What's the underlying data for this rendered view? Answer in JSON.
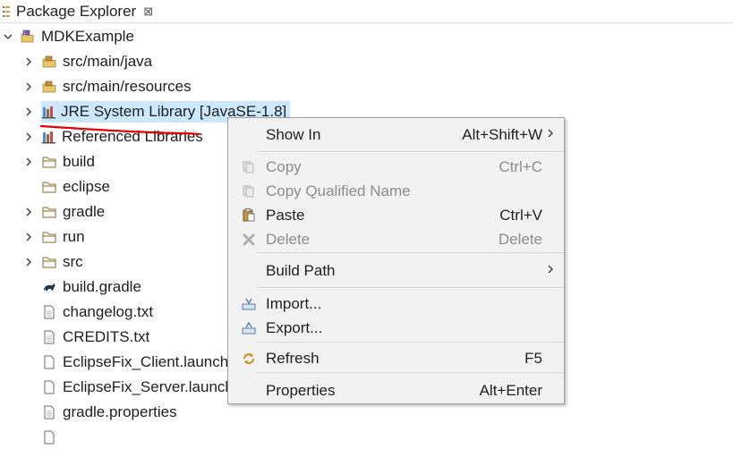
{
  "view": {
    "title": "Package Explorer",
    "close_glyph": "⊠"
  },
  "tree": {
    "project": "MDKExample",
    "items": [
      {
        "label": "src/main/java",
        "icon": "source-folder-icon"
      },
      {
        "label": "src/main/resources",
        "icon": "source-folder-icon"
      },
      {
        "label": "JRE System Library [JavaSE-1.8]",
        "icon": "library-icon",
        "selected": true
      },
      {
        "label": "Referenced Libraries",
        "icon": "library-icon"
      },
      {
        "label": "build",
        "icon": "folder-icon"
      },
      {
        "label": "eclipse",
        "icon": "folder-icon"
      },
      {
        "label": "gradle",
        "icon": "folder-icon"
      },
      {
        "label": "run",
        "icon": "folder-icon"
      },
      {
        "label": "src",
        "icon": "folder-icon"
      },
      {
        "label": "build.gradle",
        "icon": "gradle-icon"
      },
      {
        "label": "changelog.txt",
        "icon": "file-icon"
      },
      {
        "label": "CREDITS.txt",
        "icon": "file-icon"
      },
      {
        "label": "EclipseFix_Client.launch",
        "icon": "file-icon"
      },
      {
        "label": "EclipseFix_Server.launch",
        "icon": "file-icon"
      },
      {
        "label": "gradle.properties",
        "icon": "file-icon"
      }
    ]
  },
  "menu": {
    "show_in": {
      "label": "Show In",
      "shortcut": "Alt+Shift+W"
    },
    "copy": {
      "label": "Copy",
      "shortcut": "Ctrl+C"
    },
    "copy_qualified": {
      "label": "Copy Qualified Name"
    },
    "paste": {
      "label": "Paste",
      "shortcut": "Ctrl+V"
    },
    "delete": {
      "label": "Delete",
      "shortcut": "Delete"
    },
    "build_path": {
      "label": "Build Path"
    },
    "import": {
      "label": "Import..."
    },
    "export": {
      "label": "Export..."
    },
    "refresh": {
      "label": "Refresh",
      "shortcut": "F5"
    },
    "properties": {
      "label": "Properties",
      "shortcut": "Alt+Enter"
    }
  },
  "colors": {
    "selection": "#cce8ff",
    "menu_bg": "#f2f2f2",
    "annotation": "#e60000",
    "disabled_text": "#8c8c8c"
  }
}
